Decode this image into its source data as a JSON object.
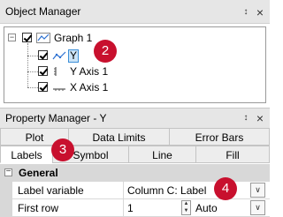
{
  "object_manager": {
    "title": "Object Manager",
    "pin_glyph": "↕",
    "close_glyph": "×",
    "tree": {
      "graph_label": "Graph 1",
      "items": [
        {
          "label": "Y",
          "selected": true
        },
        {
          "label": "Y Axis 1"
        },
        {
          "label": "X Axis 1"
        }
      ],
      "expander_glyph": "−"
    }
  },
  "property_manager": {
    "title": "Property Manager - Y",
    "pin_glyph": "↕",
    "close_glyph": "×",
    "tabs_row1": [
      "Plot",
      "Data Limits",
      "Error Bars"
    ],
    "tabs_row2": [
      "Labels",
      "Symbol",
      "Line",
      "Fill"
    ],
    "active_tab": "Labels",
    "section": {
      "label": "General",
      "expander_glyph": "−"
    },
    "rows": [
      {
        "name": "Label variable",
        "value": "Column C: Label"
      },
      {
        "name": "First row",
        "value": "1",
        "secondary": "Auto"
      }
    ],
    "dropdown_glyph": "∨"
  },
  "callouts": [
    "2",
    "3",
    "4"
  ],
  "colors": {
    "callout": "#c8102e",
    "selection": "#cce4f7"
  }
}
